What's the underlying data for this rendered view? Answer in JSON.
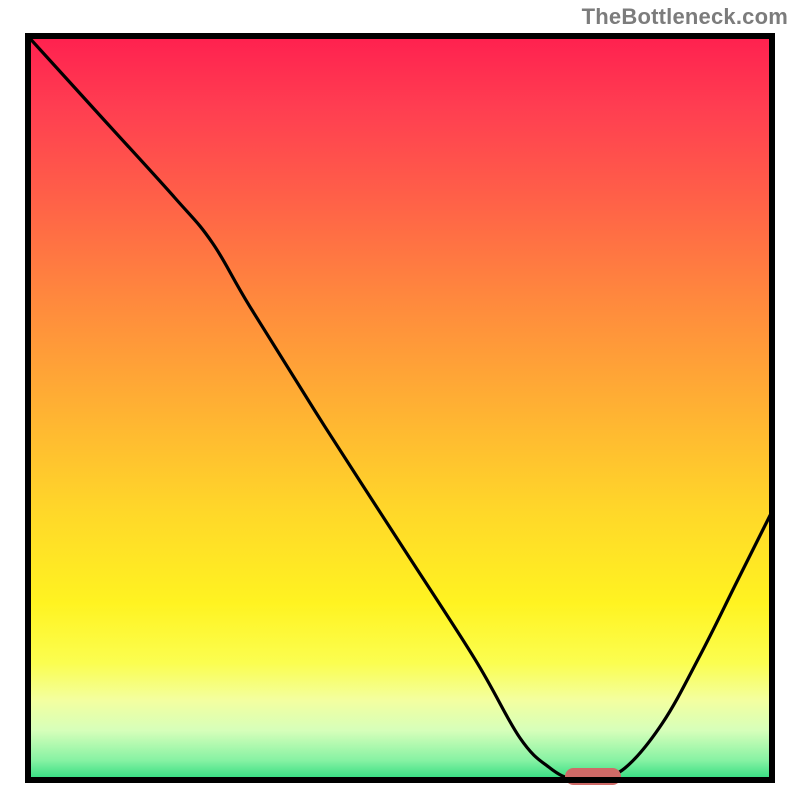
{
  "watermark": "TheBottleneck.com",
  "colors": {
    "border": "#000000",
    "curve": "#000000",
    "marker": "#cf6a67"
  },
  "chart_data": {
    "type": "line",
    "title": "",
    "xlabel": "",
    "ylabel": "",
    "xlim": [
      0,
      100
    ],
    "ylim": [
      0,
      100
    ],
    "series": [
      {
        "name": "curve",
        "x": [
          0,
          10,
          20,
          25,
          30,
          40,
          50,
          60,
          66,
          70,
          73,
          76,
          80,
          85,
          90,
          95,
          100
        ],
        "y": [
          100,
          89,
          78,
          72,
          63.5,
          47.5,
          32,
          16.5,
          6,
          2,
          0.5,
          0.5,
          2,
          8,
          17,
          27,
          37
        ]
      }
    ],
    "marker": {
      "x_range": [
        72,
        79.5
      ],
      "y_range": [
        -0.3,
        2.0
      ]
    },
    "gradient_stops": [
      {
        "pos": 0.0,
        "color": "#ff1f4f"
      },
      {
        "pos": 0.1,
        "color": "#ff3e51"
      },
      {
        "pos": 0.22,
        "color": "#ff6048"
      },
      {
        "pos": 0.36,
        "color": "#ff8a3d"
      },
      {
        "pos": 0.5,
        "color": "#ffb133"
      },
      {
        "pos": 0.64,
        "color": "#ffd829"
      },
      {
        "pos": 0.76,
        "color": "#fff321"
      },
      {
        "pos": 0.84,
        "color": "#fbfe50"
      },
      {
        "pos": 0.89,
        "color": "#f3ffa0"
      },
      {
        "pos": 0.93,
        "color": "#d6ffba"
      },
      {
        "pos": 0.97,
        "color": "#86f2a3"
      },
      {
        "pos": 1.0,
        "color": "#21d87a"
      }
    ]
  }
}
